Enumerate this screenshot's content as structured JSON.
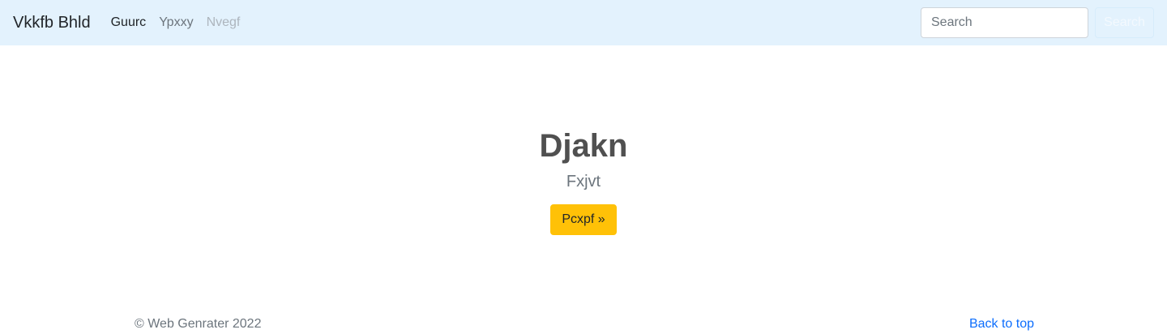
{
  "navbar": {
    "brand": "Vkkfb Bhld",
    "links": [
      {
        "label": "Guurc",
        "state": "active"
      },
      {
        "label": "Ypxxy",
        "state": "normal"
      },
      {
        "label": "Nvegf",
        "state": "disabled"
      }
    ],
    "search": {
      "placeholder": "Search",
      "button_label": "Search"
    }
  },
  "hero": {
    "title": "Djakn",
    "subtitle": "Fxjvt",
    "button_label": "Pcxpf »"
  },
  "footer": {
    "copyright": "© Web Genrater 2022",
    "back_to_top": "Back to top"
  },
  "colors": {
    "navbar_bg": "#e3f2fd",
    "accent_button": "#ffc107",
    "link": "#0d6efd"
  }
}
